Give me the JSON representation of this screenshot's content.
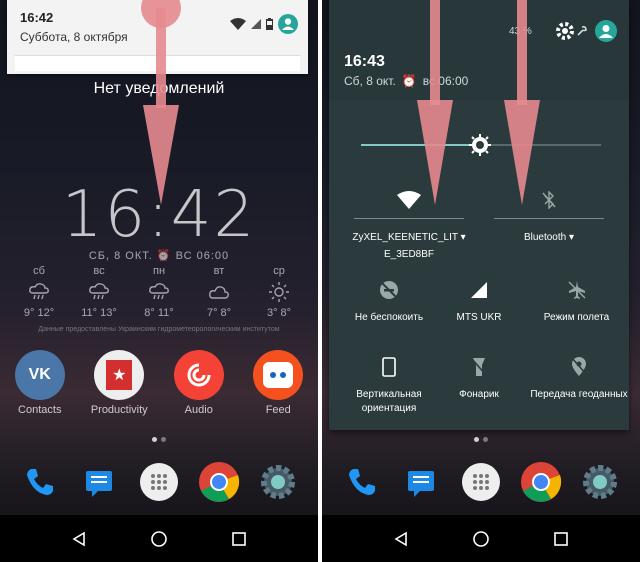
{
  "left": {
    "status": {
      "time": "16:42",
      "date": "Суббота, 8 октября"
    },
    "no_notifications": "Нет уведомлений",
    "clock": {
      "time": "16:42",
      "date_alarm": "СБ, 8 ОКТ.",
      "alarm": "ВС 06:00"
    },
    "weather": [
      {
        "day": "сб",
        "icon": "rain-icon",
        "temps": "9° 12°"
      },
      {
        "day": "вс",
        "icon": "rain-icon",
        "temps": "11° 13°"
      },
      {
        "day": "пн",
        "icon": "rain-icon",
        "temps": "8° 11°"
      },
      {
        "day": "вт",
        "icon": "cloud-icon",
        "temps": "7° 8°"
      },
      {
        "day": "ср",
        "icon": "sun-icon",
        "temps": "3° 8°"
      }
    ],
    "weather_credit": "Данные предоставлены Украинским гидрометеорологическим институтом",
    "apps": [
      {
        "label": "Contacts",
        "icon": "vk-icon",
        "color": "#4a76a8"
      },
      {
        "label": "Productivity",
        "icon": "star-folder-icon",
        "color": "#d32f2f"
      },
      {
        "label": "Audio",
        "icon": "pocketcasts-icon",
        "color": "#f44336"
      },
      {
        "label": "Feed",
        "icon": "feed-icon",
        "color": "#f4511e"
      }
    ]
  },
  "right": {
    "status": {
      "battery": "43 %"
    },
    "time": "16:43",
    "date": "Сб, 8 окт.",
    "alarm": "вс 06:00",
    "tiles": {
      "wifi": {
        "line1": "ZyXEL_KEENETIC_LIT",
        "line2": "E_3ED8BF"
      },
      "bluetooth": "Bluetooth",
      "dnd": "Не беспокоить",
      "cell": "MTS UKR",
      "airplane": "Режим полета",
      "rotation": {
        "line1": "Вертикальная",
        "line2": "ориентация"
      },
      "flashlight": "Фонарик",
      "location": "Передача геоданных"
    }
  },
  "colors": {
    "accent": "#80cbc4",
    "arrow": "#e58a8f",
    "qs_bg": "#2a3a3d"
  }
}
